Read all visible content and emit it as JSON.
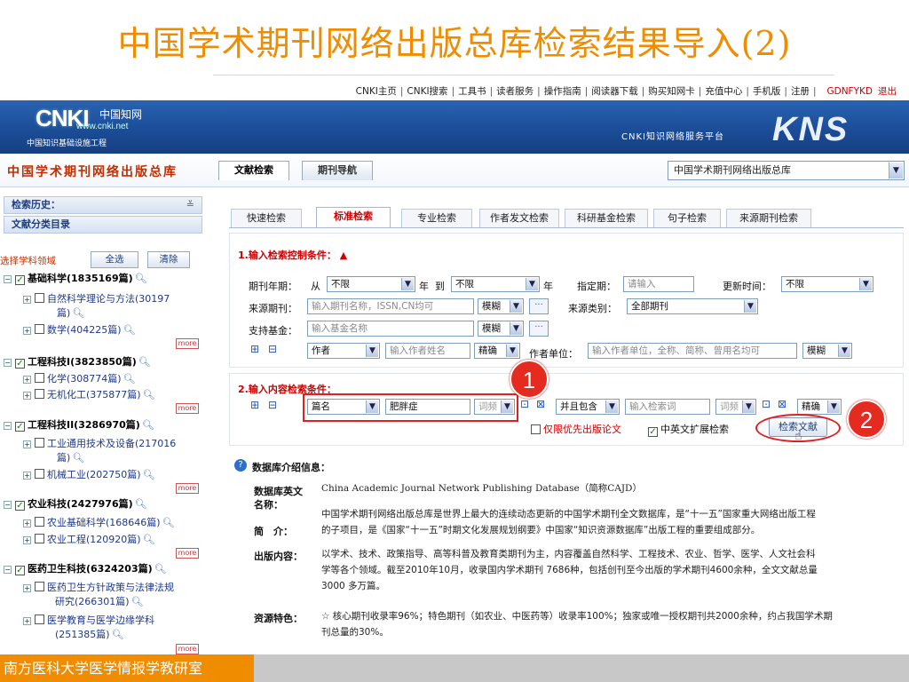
{
  "slide": {
    "title": "中国学术期刊网络出版总库检索结果导入(2)",
    "footer": "南方医科大学医学情报学教研室"
  },
  "toplinks": {
    "items": [
      "CNKI主页",
      "CNKI搜索",
      "工具书",
      "读者服务",
      "操作指南",
      "阅读器下载",
      "购买知网卡",
      "充值中心",
      "手机版",
      "注册"
    ],
    "user": "GDNFYKD",
    "logout": "退出"
  },
  "header": {
    "logo_text": "CNKI",
    "logo_cn": "中国知网",
    "logo_url": "www.cnki.net",
    "logo_sub": "中国知识基础设施工程",
    "platform": "CNKI知识网络服务平台",
    "brand": "KNS"
  },
  "dbbar": {
    "title": "中国学术期刊网络出版总库",
    "tabs": [
      "文献检索",
      "期刊导航"
    ],
    "db_select": "中国学术期刊网络出版总库"
  },
  "sidebar": {
    "history": "检索历史：",
    "classify": "文献分类目录",
    "select_label": "选择学科领域",
    "btn_all": "全选",
    "btn_clear": "清除",
    "more": "more",
    "tree": [
      {
        "label": "基础科学(1835169篇)",
        "top": true,
        "checked": true
      },
      {
        "label": "自然科学理论与方法(30197",
        "cont": "篇)"
      },
      {
        "label": "数学(404225篇)"
      },
      {
        "label": "工程科技I(3823850篇)",
        "top": true,
        "checked": true
      },
      {
        "label": "化学(308774篇)"
      },
      {
        "label": "无机化工(375877篇)"
      },
      {
        "label": "工程科技II(3286970篇)",
        "top": true,
        "checked": true
      },
      {
        "label": "工业通用技术及设备(217016",
        "cont": "篇)"
      },
      {
        "label": "机械工业(202750篇)"
      },
      {
        "label": "农业科技(2427976篇)",
        "top": true,
        "checked": true
      },
      {
        "label": "农业基础科学(168646篇)"
      },
      {
        "label": "农业工程(120920篇)"
      },
      {
        "label": "医药卫生科技(6324203篇)",
        "top": true,
        "checked": true
      },
      {
        "label": "医药卫生方针政策与法律法规",
        "cont": "研究(266301篇)"
      },
      {
        "label": "医学教育与医学边缘学科",
        "cont": "(251385篇)"
      }
    ]
  },
  "subtabs": [
    "快速检索",
    "标准检索",
    "专业检索",
    "作者发文检索",
    "科研基金检索",
    "句子检索",
    "来源期刊检索"
  ],
  "form": {
    "sec1": "1.输入检索控制条件：",
    "year_label": "期刊年期：",
    "from": "从",
    "from_val": "不限",
    "year": "年",
    "to": "到",
    "to_val": "不限",
    "year2": "年",
    "date_label": "指定期：",
    "date_ph": "请输入",
    "update_label": "更新时间：",
    "update_val": "不限",
    "source_label": "来源期刊：",
    "source_ph": "输入期刊名称，ISSN,CN均可",
    "fuzzy": "模糊",
    "source_type_label": "来源类别：",
    "source_type_val": "全部期刊",
    "fund_label": "支持基金：",
    "fund_ph": "输入基金名称",
    "author_sel": "作者",
    "author_ph": "输入作者姓名",
    "exact": "精确",
    "unit_label": "作者单位：",
    "unit_ph": "输入作者单位，全称、简称、曾用名均可",
    "sec2": "2.输入内容检索条件：",
    "field_sel": "篇名",
    "keyword": "肥胖症",
    "freq": "词频",
    "and_sel": "并且包含",
    "kw2_ph": "输入检索词",
    "first_pub": "仅限优先出版论文",
    "cn_en": "中英文扩展检索",
    "search_btn": "检索文献",
    "badge1": "1",
    "badge2": "2"
  },
  "info": {
    "heading": "数据库介绍信息：",
    "en_label": "数据库英文",
    "en_label2": "名称：",
    "en_val": "China Academic Journal Network Publishing Database（简称CAJD）",
    "brief_label": "简　介：",
    "brief_1": "中国学术期刊网络出版总库是世界上最大的连续动态更新的中国学术期刊全文数据库，是“十一五”国家重大网络出版工程",
    "brief_2": "的子项目，是《国家“十一五”时期文化发展规划纲要》中国家“知识资源数据库”出版工程的重要组成部分。",
    "content_label": "出版内容：",
    "content_1": "以学术、技术、政策指导、高等科普及教育类期刊为主，内容覆盖自然科学、工程技术、农业、哲学、医学、人文社会科",
    "content_2": "学等各个领域。截至2010年10月，收录国内学术期刊 7686种，包括创刊至今出版的学术期刊4600余种，全文文献总量",
    "content_3": "3000 多万篇。",
    "feature_label": "资源特色：",
    "feature_1": "☆ 核心期刊收录率96%；特色期刊（如农业、中医药等）收录率100%；独家或唯一授权期刊共2000余种，约占我国学术期",
    "feature_2": "刊总量的30%。"
  },
  "colors": {
    "title_orange": "#f08c00",
    "banner_blue": "#1b4d98",
    "highlight_red": "#e02020"
  }
}
